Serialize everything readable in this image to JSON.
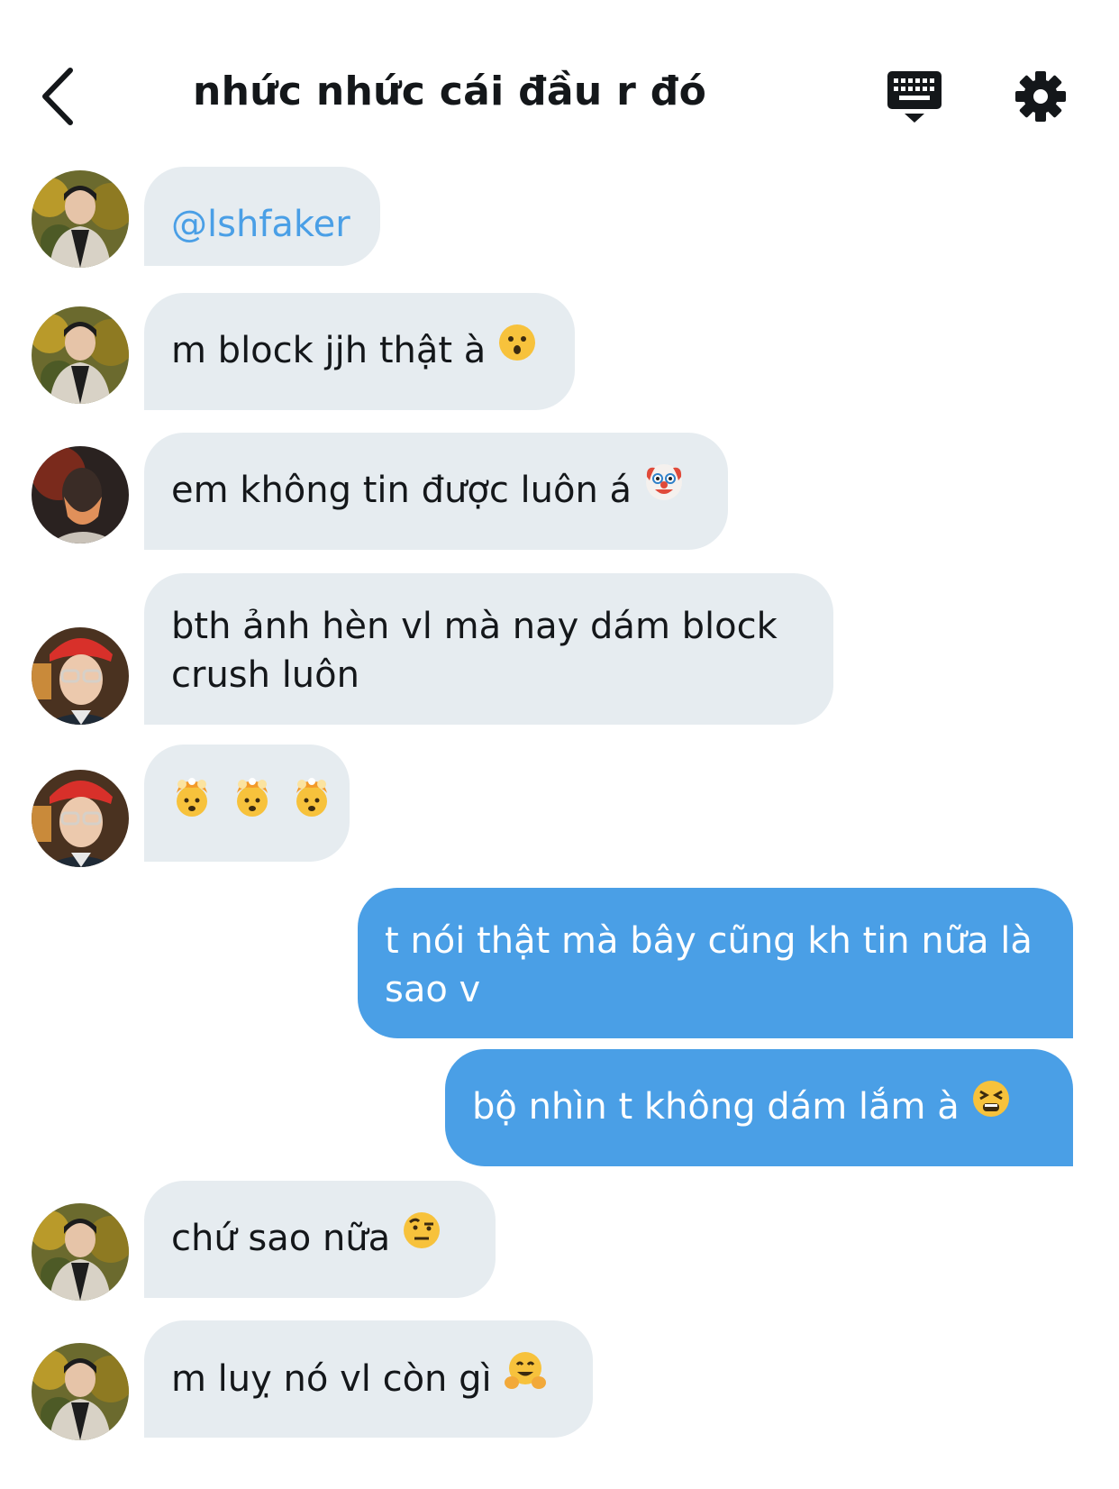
{
  "header": {
    "title": "nhức nhức cái đầu r đó",
    "back_icon": "chevron-left-icon",
    "keyboard_icon": "keyboard-icon",
    "settings_icon": "gear-icon"
  },
  "messages": [
    {
      "side": "received",
      "avatar": "avatar-a",
      "text": "@lshfaker",
      "type": "mention"
    },
    {
      "side": "received",
      "avatar": "avatar-a",
      "text": "m block jjh thật à",
      "emoji": "hushed-face"
    },
    {
      "side": "received",
      "avatar": "avatar-b",
      "text": "em không tin được luôn á",
      "emoji": "clown-face"
    },
    {
      "side": "received",
      "avatar": "avatar-c",
      "text": "bth ảnh hèn vl mà nay dám block crush luôn"
    },
    {
      "side": "received",
      "avatar": "avatar-c",
      "text": "",
      "emoji": "exploding-head x3"
    },
    {
      "side": "sent",
      "text": "t nói thật mà bây cũng kh tin nữa là sao v"
    },
    {
      "side": "sent",
      "text": "bộ nhìn t không dám lắm à",
      "emoji": "tired-face"
    },
    {
      "side": "received",
      "avatar": "avatar-a",
      "text": "chứ sao nữa",
      "emoji": "raised-eyebrow-face"
    },
    {
      "side": "received",
      "avatar": "avatar-a",
      "text": "m luỵ nó vl còn gì",
      "emoji": "hugging-face"
    }
  ],
  "colors": {
    "received_bubble": "#e6ecf0",
    "sent_bubble": "#4a9fe6",
    "mention": "#4a9fe6",
    "text": "#14171a"
  }
}
